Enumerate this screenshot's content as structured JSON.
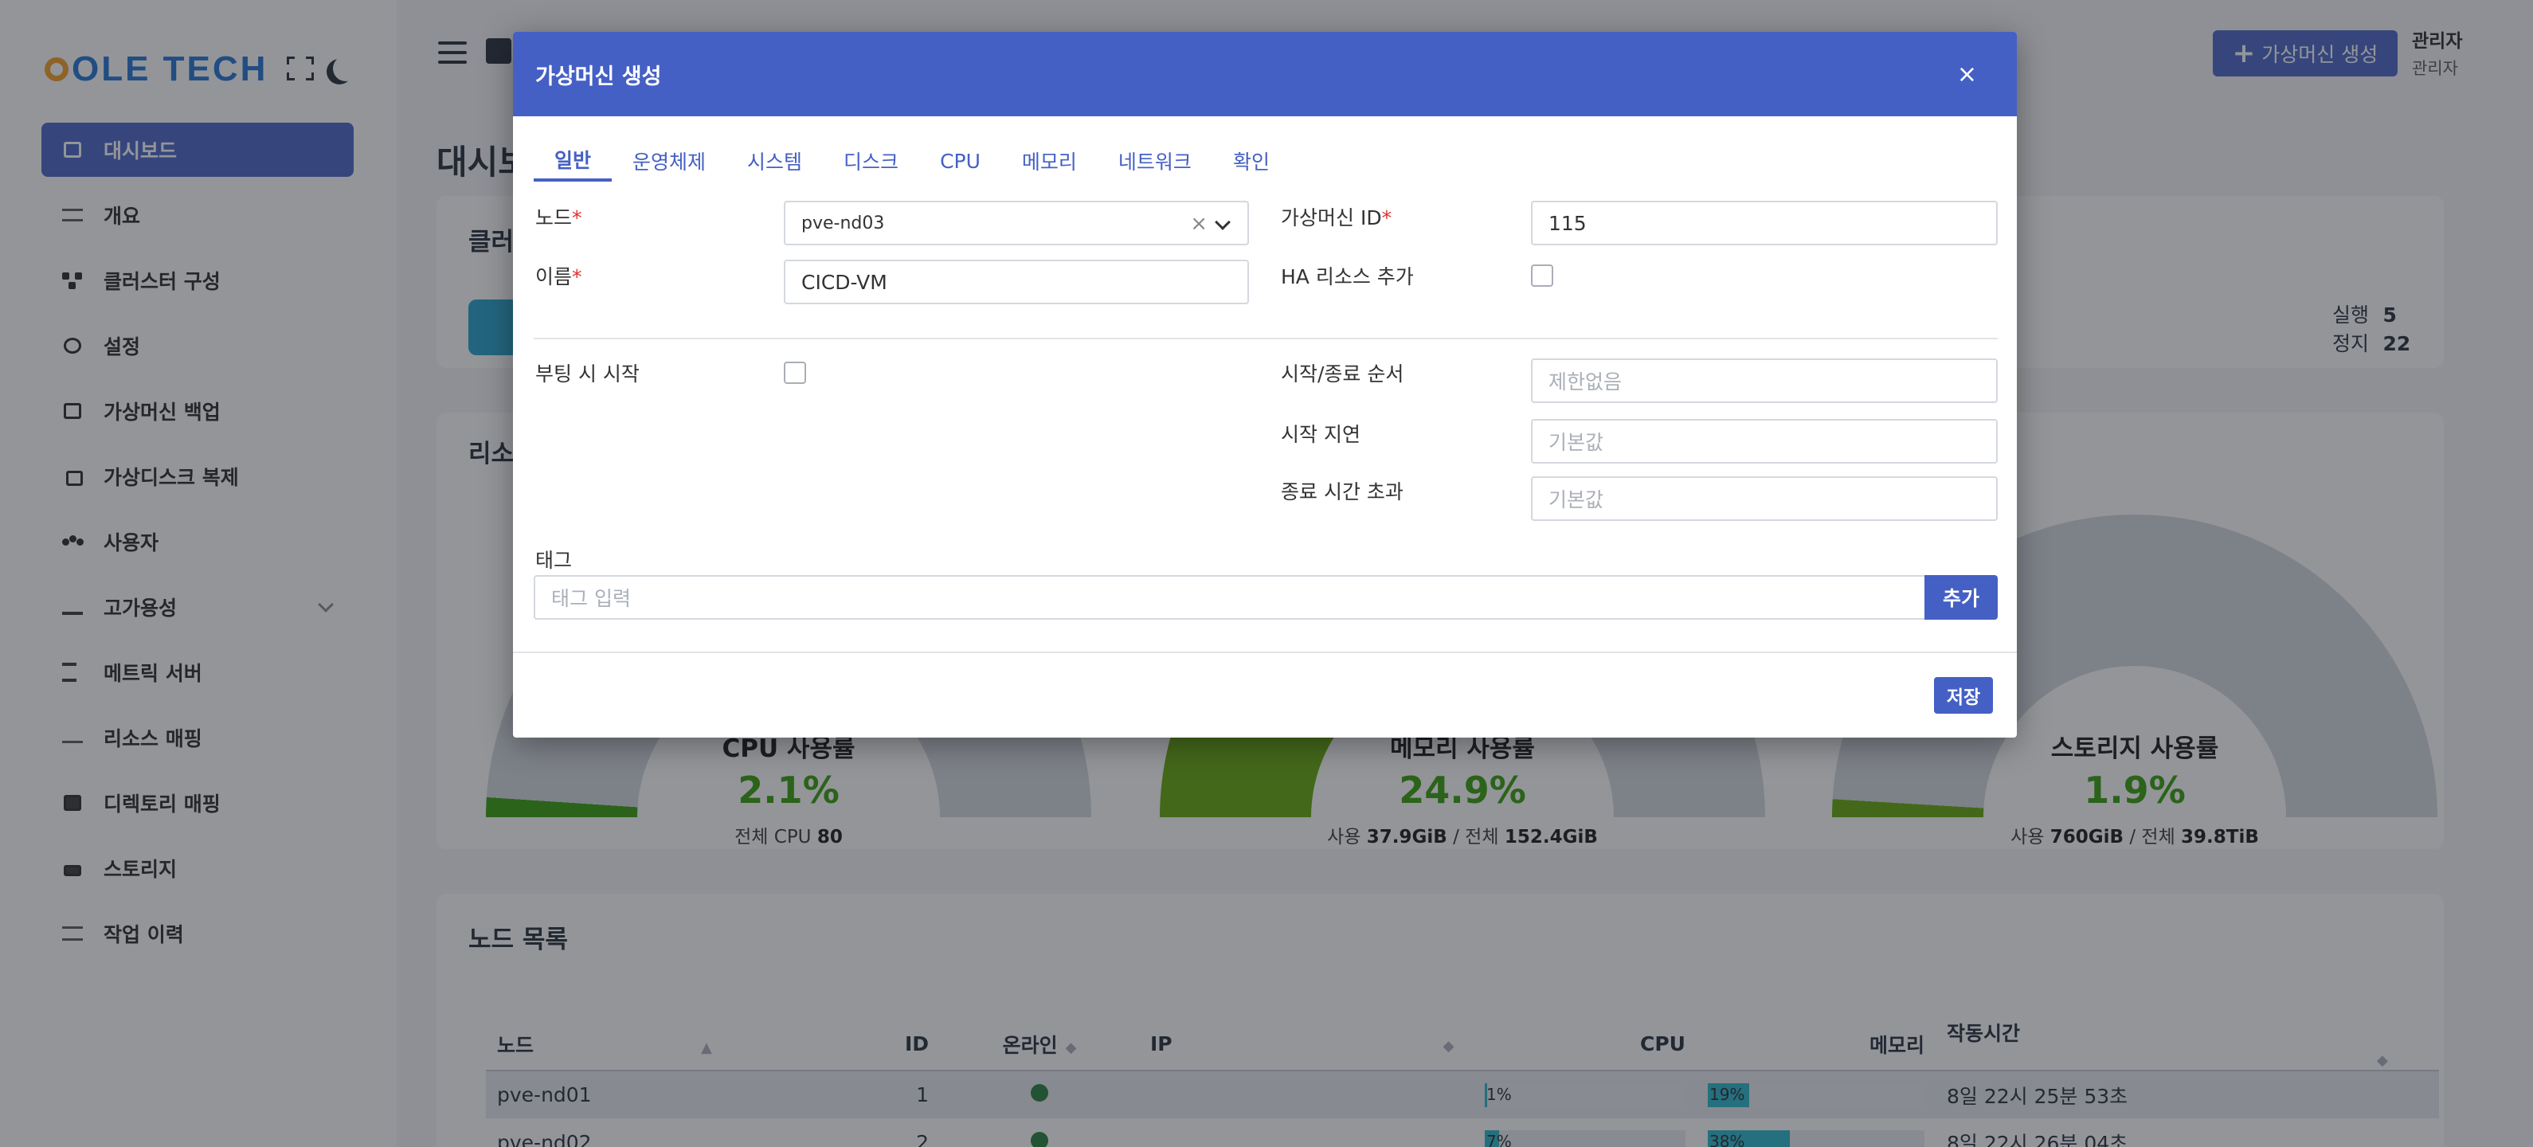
{
  "app": {
    "logo_text": "OLE TECH"
  },
  "sidebar": {
    "items": [
      {
        "label": "대시보드",
        "icon": "dashboard-icon",
        "active": true
      },
      {
        "label": "개요",
        "icon": "list-icon"
      },
      {
        "label": "클러스터 구성",
        "icon": "cluster-icon"
      },
      {
        "label": "설정",
        "icon": "gear-icon"
      },
      {
        "label": "가상머신 백업",
        "icon": "save-icon"
      },
      {
        "label": "가상디스크 복제",
        "icon": "copy-icon"
      },
      {
        "label": "사용자",
        "icon": "users-icon"
      },
      {
        "label": "고가용성",
        "icon": "upload-icon",
        "has_submenu": true
      },
      {
        "label": "메트릭 서버",
        "icon": "hourglass-icon"
      },
      {
        "label": "리소스 매핑",
        "icon": "usb-icon"
      },
      {
        "label": "디렉토리 매핑",
        "icon": "folder-icon"
      },
      {
        "label": "스토리지",
        "icon": "hdd-icon"
      },
      {
        "label": "작업 이력",
        "icon": "tasks-icon"
      }
    ]
  },
  "header": {
    "create_vm_label": "가상머신 생성",
    "user_role": "관리자",
    "user_name": "관리자"
  },
  "page": {
    "title": "대시보드",
    "cluster_title": "클러스터",
    "resource_title": "리소스",
    "vm_running_label": "실행",
    "vm_running_count": "5",
    "vm_stopped_label": "정지",
    "vm_stopped_count": "22"
  },
  "gauges": [
    {
      "title": "CPU 사용률",
      "value": "2.1%",
      "fraction": 0.021,
      "sub_prefix": "전체 CPU",
      "sub_value": "80",
      "color": "#2f9b00"
    },
    {
      "title": "메모리 사용률",
      "value": "24.9%",
      "fraction": 0.249,
      "sub_prefix": "사용",
      "sub_value": "37.9GiB",
      "sub_mid": "/ 전체",
      "sub_total": "152.4GiB",
      "color": "#5ea400"
    },
    {
      "title": "스토리지 사용률",
      "value": "1.9%",
      "fraction": 0.019,
      "sub_prefix": "사용",
      "sub_value": "760GiB",
      "sub_mid": "/ 전체",
      "sub_total": "39.8TiB",
      "color": "#5ea400"
    }
  ],
  "node_list": {
    "title": "노드 목록",
    "columns": [
      "노드",
      "ID",
      "온라인",
      "IP",
      "CPU",
      "메모리",
      "작동시간"
    ],
    "rows": [
      {
        "node": "pve-nd01",
        "id": "1",
        "ip": "",
        "cpu": "1%",
        "cpu_frac": 0.01,
        "mem": "19%",
        "mem_frac": 0.19,
        "uptime": "8일 22시 25분 53초"
      },
      {
        "node": "pve-nd02",
        "id": "2",
        "ip": "",
        "cpu": "7%",
        "cpu_frac": 0.07,
        "mem": "38%",
        "mem_frac": 0.38,
        "uptime": "8일 22시 26분 04초"
      }
    ]
  },
  "modal": {
    "title": "가상머신 생성",
    "close": "×",
    "tabs": [
      "일반",
      "운영체제",
      "시스템",
      "디스크",
      "CPU",
      "메모리",
      "네트워크",
      "확인"
    ],
    "node_label": "노드",
    "node_value": "pve-nd03",
    "node_clear": "×",
    "vmid_label": "가상머신 ID",
    "vmid_value": "115",
    "name_label": "이름",
    "name_value": "CICD-VM",
    "ha_label": "HA 리소스 추가",
    "boot_label": "부팅 시 시작",
    "order_label": "시작/종료 순서",
    "order_placeholder": "제한없음",
    "delay_label": "시작 지연",
    "delay_placeholder": "기본값",
    "timeout_label": "종료 시간 초과",
    "timeout_placeholder": "기본값",
    "tag_label": "태그",
    "tag_placeholder": "태그 입력",
    "add_label": "추가",
    "save_label": "저장",
    "required_mark": "*"
  }
}
